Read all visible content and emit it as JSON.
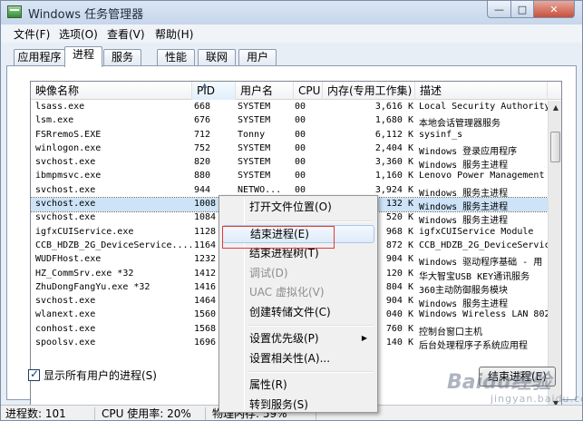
{
  "window": {
    "title": "Windows 任务管理器",
    "min_symbol": "—",
    "max_symbol": "□",
    "close_symbol": "✕"
  },
  "menu": [
    "文件(F)",
    "选项(O)",
    "查看(V)",
    "帮助(H)"
  ],
  "tabs": [
    "应用程序",
    "进程",
    "服务",
    "性能",
    "联网",
    "用户"
  ],
  "active_tab": "进程",
  "table": {
    "columns": [
      "映像名称",
      "PID",
      "用户名",
      "CPU",
      "内存(专用工作集)",
      "描述"
    ],
    "sorted_column": "PID",
    "sort_symbol": "▲",
    "rows": [
      [
        "lsass.exe",
        "668",
        "SYSTEM",
        "00",
        "3,616 K",
        "Local Security Authority"
      ],
      [
        "lsm.exe",
        "676",
        "SYSTEM",
        "00",
        "1,680 K",
        "本地会话管理器服务"
      ],
      [
        "FSRremoS.EXE",
        "712",
        "Tonny",
        "00",
        "6,112 K",
        "sysinf_s"
      ],
      [
        "winlogon.exe",
        "752",
        "SYSTEM",
        "00",
        "2,404 K",
        "Windows 登录应用程序"
      ],
      [
        "svchost.exe",
        "820",
        "SYSTEM",
        "00",
        "3,360 K",
        "Windows 服务主进程"
      ],
      [
        "ibmpmsvc.exe",
        "880",
        "SYSTEM",
        "00",
        "1,160 K",
        "Lenovo Power Management"
      ],
      [
        "svchost.exe",
        "944",
        "NETWO...",
        "00",
        "3,924 K",
        "Windows 服务主进程"
      ],
      [
        "svchost.exe",
        "1008",
        "",
        "",
        "132 K",
        "Windows 服务主进程"
      ],
      [
        "svchost.exe",
        "1084",
        "",
        "",
        "520 K",
        "Windows 服务主进程"
      ],
      [
        "igfxCUIService.exe",
        "1128",
        "",
        "",
        "968 K",
        "igfxCUIService Module"
      ],
      [
        "CCB_HDZB_2G_DeviceService....",
        "1164",
        "",
        "",
        "872 K",
        "CCB_HDZB_2G_DeviceService"
      ],
      [
        "WUDFHost.exe",
        "1232",
        "",
        "",
        "904 K",
        "Windows 驱动程序基础 - 用"
      ],
      [
        "HZ_CommSrv.exe *32",
        "1412",
        "",
        "",
        "120 K",
        "华大智宝USB KEY通讯服务"
      ],
      [
        "ZhuDongFangYu.exe *32",
        "1416",
        "",
        "",
        "804 K",
        "360主动防御服务模块"
      ],
      [
        "svchost.exe",
        "1464",
        "",
        "",
        "904 K",
        "Windows 服务主进程"
      ],
      [
        "wlanext.exe",
        "1560",
        "",
        "",
        "040 K",
        "Windows Wireless LAN 802"
      ],
      [
        "conhost.exe",
        "1568",
        "",
        "",
        "760 K",
        "控制台窗口主机"
      ],
      [
        "spoolsv.exe",
        "1696",
        "",
        "",
        "140 K",
        "后台处理程序子系统应用程"
      ]
    ],
    "selected_row": 7,
    "scroll_up": "▲",
    "scroll_down": "▼"
  },
  "show_all_users": {
    "label": "显示所有用户的进程(S)",
    "checked": true
  },
  "end_process_button": "结束进程(E)",
  "context_menu": {
    "items": [
      {
        "label": "打开文件位置(O)",
        "enabled": true
      },
      {
        "separator": true
      },
      {
        "label": "结束进程(E)",
        "enabled": true,
        "highlighted": true
      },
      {
        "label": "结束进程树(T)",
        "enabled": true
      },
      {
        "label": "调试(D)",
        "enabled": false
      },
      {
        "label": "UAC 虚拟化(V)",
        "enabled": false
      },
      {
        "label": "创建转储文件(C)",
        "enabled": true
      },
      {
        "separator": true
      },
      {
        "label": "设置优先级(P)",
        "enabled": true,
        "submenu": true
      },
      {
        "label": "设置相关性(A)...",
        "enabled": true
      },
      {
        "separator": true
      },
      {
        "label": "属性(R)",
        "enabled": true
      },
      {
        "label": "转到服务(S)",
        "enabled": true
      }
    ],
    "submenu_arrow": "▶"
  },
  "status": {
    "processes": "进程数: 101",
    "cpu": "CPU 使用率: 20%",
    "memory": "物理内存: 59%"
  },
  "watermark": {
    "brand": "Baidu经验",
    "sub": "jingyan.baidu.com"
  },
  "colors": {
    "selection": "#cde3f7",
    "highlight_box": "#e63838",
    "menu_highlight": "#deebf9"
  }
}
